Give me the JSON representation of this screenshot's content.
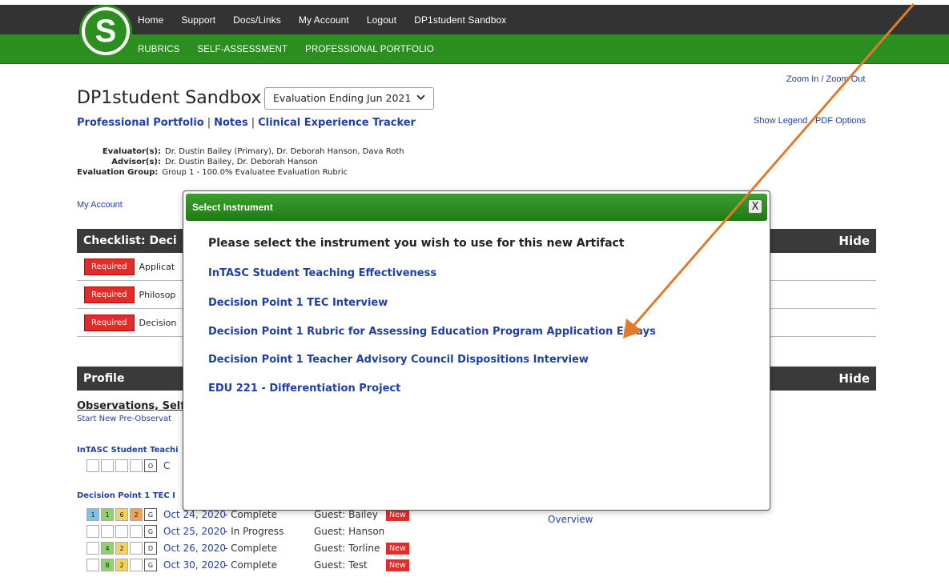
{
  "nav": {
    "top": [
      "Home",
      "Support",
      "Docs/Links",
      "My Account",
      "Logout",
      "DP1student Sandbox"
    ],
    "bottom": [
      "RUBRICS",
      "SELF-ASSESSMENT",
      "PROFESSIONAL PORTFOLIO"
    ],
    "logo_letter": "S"
  },
  "zoom": {
    "in": "Zoom In",
    "sep": " / ",
    "out": "Zoom Out"
  },
  "legend": "Show Legend - PDF Options",
  "page_title": "DP1student Sandbox",
  "evaluation_select": {
    "value": "Evaluation Ending Jun 2021",
    "chevron": "⌵"
  },
  "subnav": [
    "Professional Portfolio",
    "Notes",
    "Clinical Experience Tracker"
  ],
  "meta": {
    "evaluators_label": "Evaluator(s):",
    "evaluators": "Dr. Dustin Bailey (Primary), Dr. Deborah Hanson, Dava Roth",
    "advisors_label": "Advisor(s):",
    "advisors": "Dr. Dustin Bailey, Dr. Deborah Hanson",
    "group_label": "Evaluation Group:",
    "group": "Group 1 - 100.0% Evaluatee Evaluation Rubric"
  },
  "my_account": "My Account",
  "checklist": {
    "title": "Checklist: Deci",
    "hide": "Hide",
    "items": [
      {
        "badge": "Required",
        "text": "Applicat"
      },
      {
        "badge": "Required",
        "text": "Philosop"
      },
      {
        "badge": "Required",
        "text": "Decision"
      }
    ]
  },
  "profile": {
    "title": "Profile",
    "hide": "Hide"
  },
  "observations": {
    "heading": "Observations, Self",
    "start_link": "Start New Pre-Observat",
    "intasc_label": "InTASC Student Teachi",
    "intasc_cells": [
      "",
      "",
      "",
      "",
      "O",
      "C"
    ],
    "dp1_label": "Decision Point 1 TEC I",
    "rows": [
      {
        "cells": [
          "1",
          "1",
          "6",
          "2",
          "G"
        ],
        "date": "Oct 24, 2020",
        "status": " - Complete",
        "guest": "Guest: Bailey",
        "badge": "New"
      },
      {
        "cells": [
          "",
          "",
          "",
          "",
          "G"
        ],
        "date": "Oct 25, 2020",
        "status": " - In Progress",
        "guest": "Guest: Hanson",
        "badge": ""
      },
      {
        "cells": [
          "",
          "4",
          "2",
          "",
          "D"
        ],
        "date": "Oct 26, 2020",
        "status": " - Complete",
        "guest": "Guest: Torline",
        "badge": "New"
      },
      {
        "cells": [
          "",
          "8",
          "2",
          "",
          "G"
        ],
        "date": "Oct 30, 2020",
        "status": " - Complete",
        "guest": "Guest: Test",
        "badge": "New"
      }
    ],
    "overview": "Overview"
  },
  "modal": {
    "title": "Select Instrument",
    "close": "X",
    "prompt": "Please select the instrument you wish to use for this new Artifact",
    "instruments": [
      "InTASC Student Teaching Effectiveness",
      "Decision Point 1 TEC Interview",
      "Decision Point 1 Rubric for Assessing Education Program Application Essays",
      "Decision Point 1 Teacher Advisory Council Dispositions Interview",
      "EDU 221 - Differentiation Project"
    ]
  },
  "colors": {
    "nav_dark": "#333333",
    "nav_green": "#2a8f1e",
    "link_blue": "#1f3fa6",
    "required_red": "#e22b2b",
    "annotation_arrow": "#e07a2c"
  }
}
